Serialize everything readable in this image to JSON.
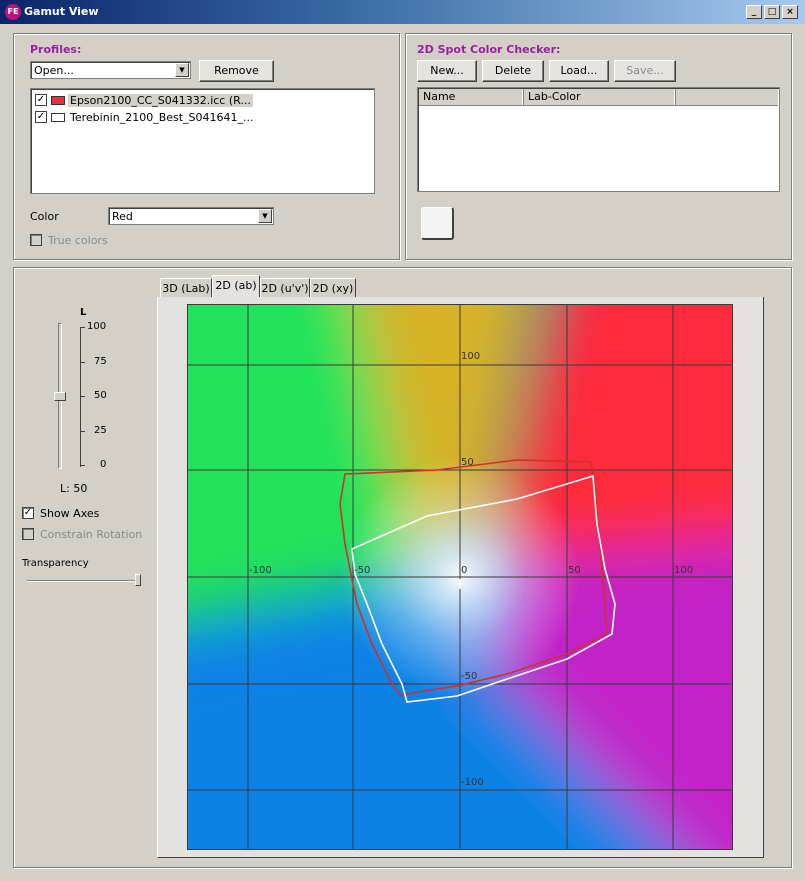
{
  "window": {
    "title": "Gamut View"
  },
  "profiles": {
    "title": "Profiles:",
    "open_combo": "Open...",
    "remove_label": "Remove",
    "items": [
      {
        "name": "Epson2100_CC_S041332.icc (R...",
        "checked": true,
        "color": "#e8323a"
      },
      {
        "name": "Terebinin_2100_Best_S041641_...",
        "checked": true,
        "color": "#ffffff"
      }
    ],
    "color_label": "Color",
    "color_value": "Red",
    "true_colors_label": "True colors"
  },
  "spot_checker": {
    "title": "2D Spot Color Checker:",
    "buttons": [
      "New...",
      "Delete",
      "Load...",
      "Save..."
    ],
    "columns": [
      "Name",
      "Lab-Color"
    ]
  },
  "controls": {
    "slider_title": "L",
    "slider_ticks": [
      "100",
      "75",
      "50",
      "25",
      "0"
    ],
    "slider_value_label": "L: 50",
    "show_axes_label": "Show Axes",
    "constrain_rotation_label": "Constrain Rotation",
    "transparency_label": "Transparency"
  },
  "tabs": [
    "3D (Lab)",
    "2D (ab)",
    "2D (u'v')",
    "2D (xy)"
  ],
  "plot": {
    "axis_labels": {
      "b_top": "100",
      "b_mid": "50",
      "b_neg_mid": "-50",
      "b_neg": "-100",
      "a_neg": "-100",
      "a_neg_mid": "-50",
      "origin": "0",
      "a_mid": "50",
      "a_pos": "100"
    },
    "colors": {
      "green": "#20e35a",
      "yellow": "#d8b227",
      "red": "#ff2a3a",
      "blue": "#0a82e6",
      "magenta": "#c220c8",
      "gamut1": "#d0302a",
      "gamut2": "#ffffff"
    }
  }
}
